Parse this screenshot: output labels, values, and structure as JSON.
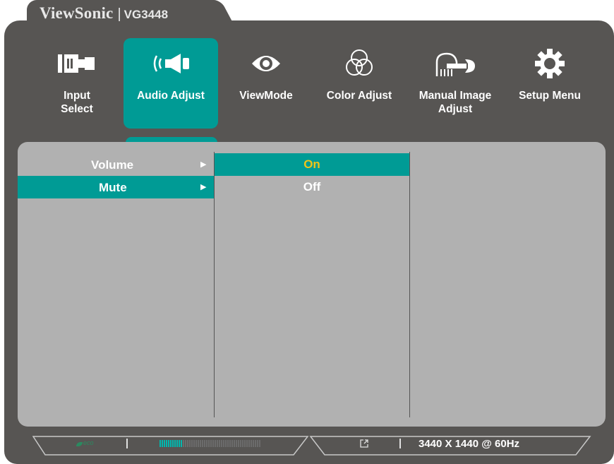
{
  "brand": {
    "name": "ViewSonic",
    "separator": "|",
    "model": "VG3448"
  },
  "menu": [
    {
      "label": "Input\nSelect",
      "icon": "input-select-icon",
      "active": false
    },
    {
      "label": "Audio Adjust",
      "icon": "speaker-icon",
      "active": true
    },
    {
      "label": "ViewMode",
      "icon": "eye-icon",
      "active": false
    },
    {
      "label": "Color Adjust",
      "icon": "color-circles-icon",
      "active": false
    },
    {
      "label": "Manual Image\nAdjust",
      "icon": "hand-wrench-icon",
      "active": false
    },
    {
      "label": "Setup Menu",
      "icon": "gear-icon",
      "active": false
    }
  ],
  "submenu": {
    "items": [
      {
        "label": "Volume",
        "arrow": "▶",
        "selected": false
      },
      {
        "label": "Mute",
        "arrow": "▶",
        "selected": true
      }
    ],
    "options": [
      {
        "label": "On",
        "current": true
      },
      {
        "label": "Off",
        "current": false
      }
    ]
  },
  "status_bar": {
    "eco_label": "eco",
    "meter_level": 0.23,
    "resolution": "3440 X 1440 @ 60Hz"
  },
  "colors": {
    "accent": "#009b95",
    "frame": "#575553",
    "panel": "#b1b1b1",
    "current_option_text": "#f0c419"
  }
}
